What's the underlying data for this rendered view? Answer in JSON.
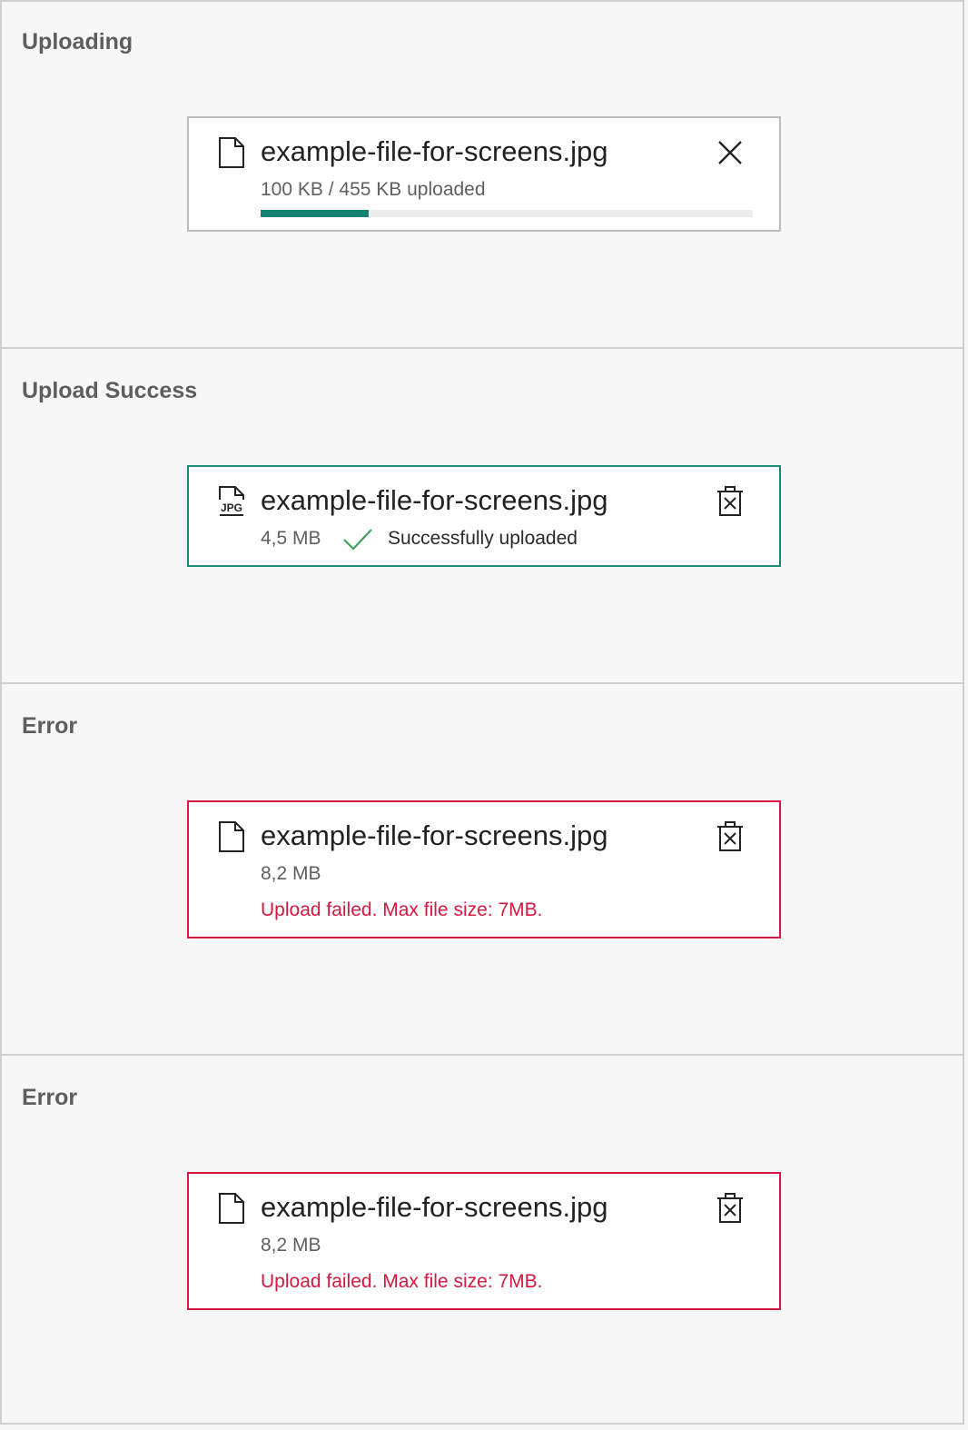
{
  "sections": [
    {
      "title": "Uploading",
      "file": {
        "name": "example-file-for-screens.jpg",
        "status_text": "100 KB / 455 KB uploaded",
        "progress_fraction": 0.2198,
        "icon": "file-icon",
        "action_icon": "close-icon"
      }
    },
    {
      "title": "Upload Success",
      "file": {
        "name": "example-file-for-screens.jpg",
        "size": "4,5 MB",
        "success_text": "Successfully uploaded",
        "icon": "jpg-file-icon",
        "action_icon": "delete-icon"
      }
    },
    {
      "title": "Error",
      "file": {
        "name": "example-file-for-screens.jpg",
        "size": "8,2 MB",
        "error_text": "Upload failed. Max file size: 7MB.",
        "icon": "file-icon",
        "action_icon": "delete-icon"
      }
    },
    {
      "title": "Error",
      "file": {
        "name": "example-file-for-screens.jpg",
        "size": "8,2 MB",
        "error_text": "Upload failed. Max file size: 7MB.",
        "icon": "file-icon",
        "action_icon": "delete-icon"
      }
    }
  ],
  "colors": {
    "progress": "#138274",
    "success_border": "#1a8a7d",
    "success_check": "#3fa35b",
    "error": "#d4183f"
  }
}
